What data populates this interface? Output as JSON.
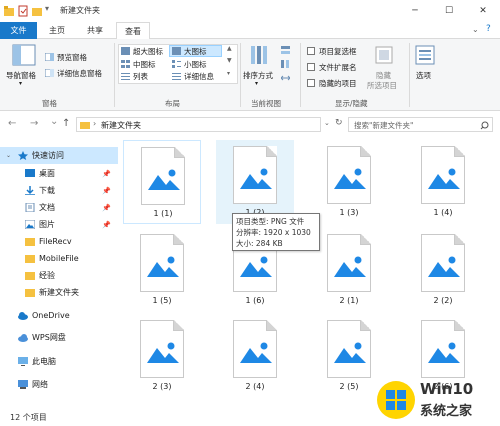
{
  "window": {
    "title": "新建文件夹",
    "controls": {
      "minimize": "─",
      "maximize": "☐",
      "close": "✕"
    }
  },
  "tabs": [
    {
      "label": "文件"
    },
    {
      "label": "主页"
    },
    {
      "label": "共享"
    },
    {
      "label": "查看"
    }
  ],
  "ribbon": {
    "pane": {
      "nav_pane": "导航窗格",
      "preview": "预览窗格",
      "details": "详细信息窗格",
      "group": "窗格"
    },
    "layout": {
      "items": [
        "超大图标",
        "大图标",
        "中图标",
        "小图标",
        "列表",
        "详细信息"
      ],
      "group": "布局"
    },
    "current_view": {
      "sort": "排序方式",
      "group": "当前视图"
    },
    "show_hide": {
      "item_checkbox": "项目复选框",
      "ext": "文件扩展名",
      "hidden": "隐藏的项目",
      "hide_selected_1": "隐藏",
      "hide_selected_2": "所选项目",
      "options": "选项",
      "group": "显示/隐藏"
    }
  },
  "address": {
    "back": "←",
    "forward": "→",
    "down": "⌄",
    "up": "↑",
    "path": "新建文件夹",
    "search_placeholder": "搜索\"新建文件夹\""
  },
  "nav": {
    "quick_access": "快速访问",
    "items": [
      {
        "label": "桌面"
      },
      {
        "label": "下载"
      },
      {
        "label": "文档"
      },
      {
        "label": "图片"
      },
      {
        "label": "FileRecv"
      },
      {
        "label": "MobileFile"
      },
      {
        "label": "经验"
      },
      {
        "label": "新建文件夹"
      }
    ],
    "onedrive": "OneDrive",
    "wps": "WPS网盘",
    "this_pc": "此电脑",
    "network": "网络"
  },
  "files": [
    {
      "name": "1 (1)"
    },
    {
      "name": "1 (2)"
    },
    {
      "name": "1 (3)"
    },
    {
      "name": "1 (4)"
    },
    {
      "name": "1 (5)"
    },
    {
      "name": "1 (6)"
    },
    {
      "name": "2 (1)"
    },
    {
      "name": "2 (2)"
    },
    {
      "name": "2 (3)"
    },
    {
      "name": "2 (4)"
    },
    {
      "name": "2 (5)"
    },
    {
      "name": "2 (6)"
    }
  ],
  "tooltip": {
    "type": "项目类型: PNG 文件",
    "resolution": "分辨率: 1920 x 1030",
    "size": "大小: 284 KB"
  },
  "status": {
    "count": "12 个项目"
  },
  "watermark": {
    "line1": "Win10",
    "line2": "系统之家"
  },
  "colors": {
    "accent": "#1979ca",
    "selected": "#e5f3fb",
    "image_blue": "#1e88e5",
    "folder": "#f5c140"
  }
}
